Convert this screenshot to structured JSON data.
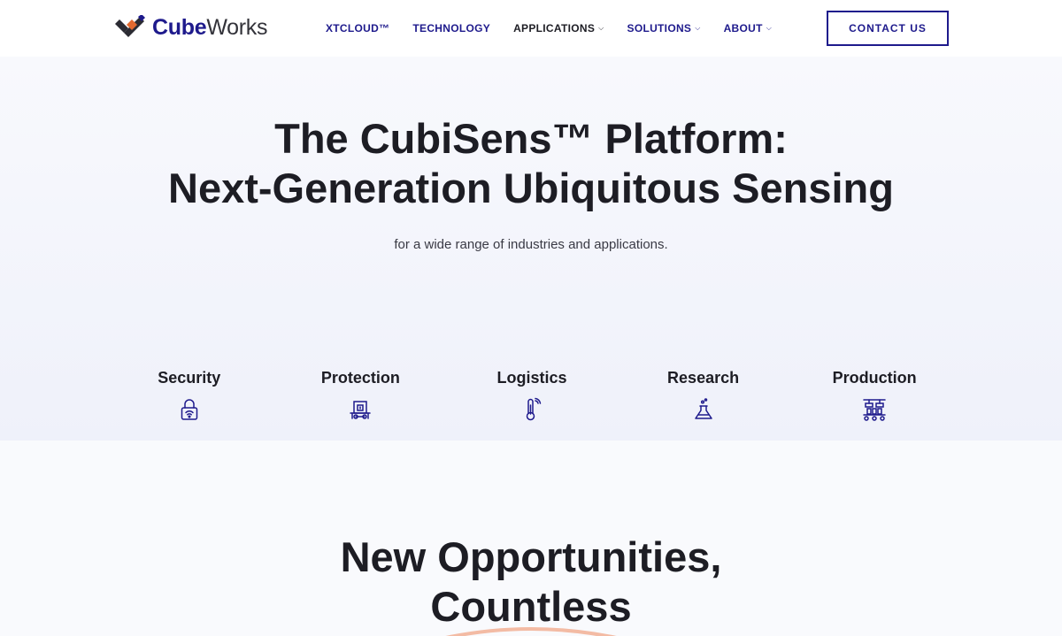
{
  "header": {
    "logo": {
      "part1": "Cube",
      "part2": "Works"
    },
    "nav": [
      {
        "label": "XTCLOUD™",
        "dropdown": false
      },
      {
        "label": "TECHNOLOGY",
        "dropdown": false
      },
      {
        "label": "APPLICATIONS",
        "dropdown": true
      },
      {
        "label": "SOLUTIONS",
        "dropdown": true
      },
      {
        "label": "ABOUT",
        "dropdown": true
      }
    ],
    "caret": "⌵",
    "cta_label": "CONTACT US"
  },
  "hero": {
    "title_line1": "The CubiSens™ Platform:",
    "title_line2": "Next-Generation Ubiquitous Sensing",
    "subtitle": "for a wide range of industries and applications.",
    "categories": [
      {
        "label": "Security",
        "icon": "lock-wifi-icon"
      },
      {
        "label": "Protection",
        "icon": "protected-display-icon"
      },
      {
        "label": "Logistics",
        "icon": "thermometer-signal-icon"
      },
      {
        "label": "Research",
        "icon": "flask-icon"
      },
      {
        "label": "Production",
        "icon": "factory-line-icon"
      }
    ]
  },
  "section2": {
    "title_line1": "New Opportunities,",
    "title_line2": "Countless"
  },
  "colors": {
    "brand_navy": "#1e1a8c",
    "logo_orange": "#e2692f",
    "text_dark": "#1d1d24",
    "accent_arc": "#f0a585"
  }
}
